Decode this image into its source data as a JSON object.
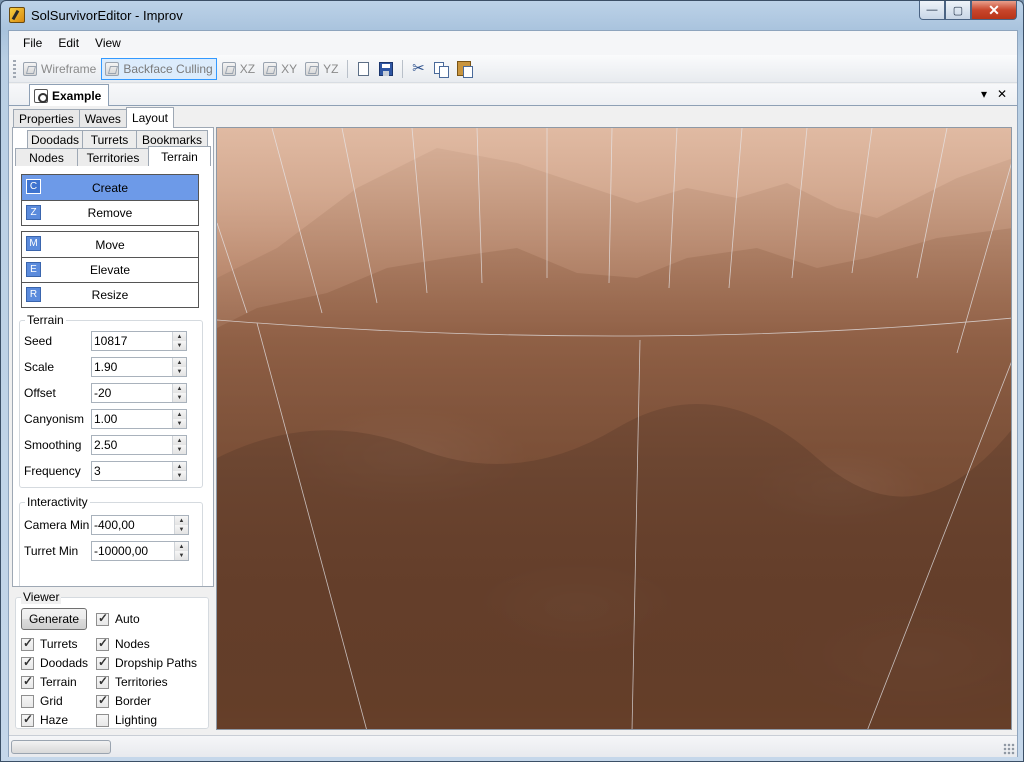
{
  "window": {
    "title": "SolSurvivorEditor - Improv",
    "controls": [
      "—",
      "▢",
      "✕"
    ]
  },
  "menu": {
    "items": [
      "File",
      "Edit",
      "View"
    ]
  },
  "toolbar": {
    "wireframe": "Wireframe",
    "backface_culling": "Backface Culling",
    "xz": "XZ",
    "xy": "XY",
    "yz": "YZ"
  },
  "document": {
    "tab": "Example",
    "dropdown_glyph": "▾",
    "close_glyph": "✕"
  },
  "panel_tabs": [
    "Properties",
    "Waves",
    "Layout"
  ],
  "layout_tabs": {
    "row1": [
      "Doodads",
      "Turrets",
      "Bookmarks"
    ],
    "row2": [
      "Nodes",
      "Territories",
      "Terrain"
    ]
  },
  "tools": {
    "group1": [
      {
        "key": "C",
        "label": "Create",
        "selected": true
      },
      {
        "key": "Z",
        "label": "Remove",
        "selected": false
      }
    ],
    "group2": [
      {
        "key": "M",
        "label": "Move"
      },
      {
        "key": "E",
        "label": "Elevate"
      },
      {
        "key": "R",
        "label": "Resize"
      }
    ]
  },
  "terrain": {
    "title": "Terrain",
    "fields": [
      {
        "label": "Seed",
        "value": "10817"
      },
      {
        "label": "Scale",
        "value": "1.90"
      },
      {
        "label": "Offset",
        "value": "-20"
      },
      {
        "label": "Canyonism",
        "value": "1.00"
      },
      {
        "label": "Smoothing",
        "value": "2.50"
      },
      {
        "label": "Frequency",
        "value": "3"
      }
    ]
  },
  "interactivity": {
    "title": "Interactivity",
    "fields": [
      {
        "label": "Camera Min",
        "value": "-400,00"
      },
      {
        "label": "Turret Min",
        "value": "-10000,00"
      }
    ]
  },
  "viewer": {
    "title": "Viewer",
    "generate": "Generate",
    "auto": {
      "label": "Auto",
      "checked": true
    },
    "options": [
      {
        "label": "Turrets",
        "checked": true
      },
      {
        "label": "Nodes",
        "checked": true
      },
      {
        "label": "Doodads",
        "checked": true
      },
      {
        "label": "Dropship Paths",
        "checked": true
      },
      {
        "label": "Terrain",
        "checked": true
      },
      {
        "label": "Territories",
        "checked": true
      },
      {
        "label": "Grid",
        "checked": false
      },
      {
        "label": "Border",
        "checked": true
      },
      {
        "label": "Haze",
        "checked": true
      },
      {
        "label": "Lighting",
        "checked": false
      }
    ]
  },
  "colors": {
    "selected_tool": "#6d9ae8",
    "tool_key": "#5b8bdc",
    "terrain_dark": "#5e3a28",
    "haze": "#d5a98f"
  }
}
